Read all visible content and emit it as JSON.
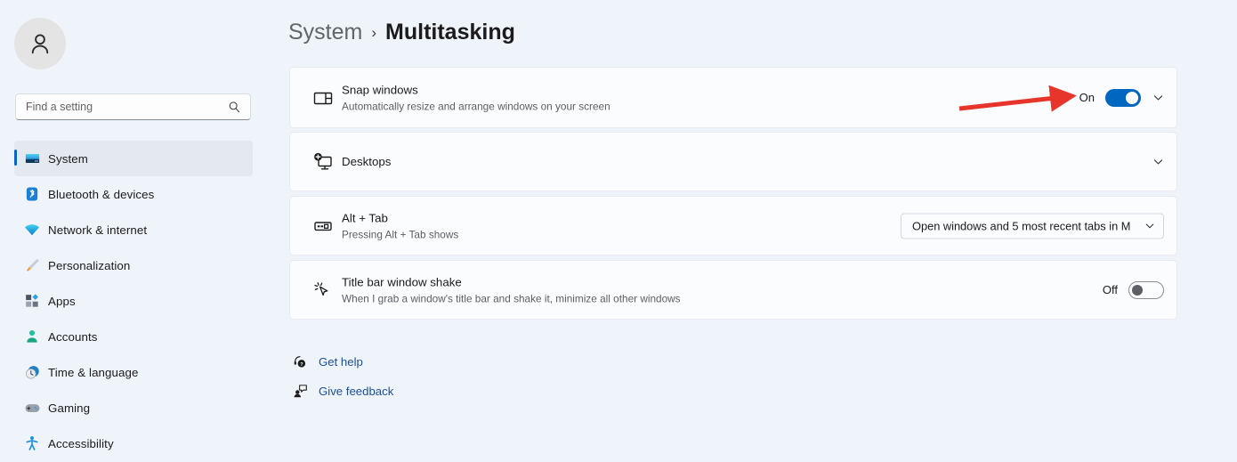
{
  "window": {
    "accent_color": "#0067c0",
    "background_color": "#eff3fa",
    "card_color": "#fbfcfe"
  },
  "sidebar": {
    "avatar": {
      "icon": "person-icon"
    },
    "search": {
      "placeholder": "Find a setting",
      "value": "",
      "icon": "search-icon"
    },
    "items": [
      {
        "label": "System",
        "icon": "monitor-icon",
        "selected": true
      },
      {
        "label": "Bluetooth & devices",
        "icon": "bluetooth-icon",
        "selected": false
      },
      {
        "label": "Network & internet",
        "icon": "wifi-icon",
        "selected": false
      },
      {
        "label": "Personalization",
        "icon": "paintbrush-icon",
        "selected": false
      },
      {
        "label": "Apps",
        "icon": "apps-grid-icon",
        "selected": false
      },
      {
        "label": "Accounts",
        "icon": "account-person-icon",
        "selected": false
      },
      {
        "label": "Time & language",
        "icon": "clock-globe-icon",
        "selected": false
      },
      {
        "label": "Gaming",
        "icon": "gamepad-icon",
        "selected": false
      },
      {
        "label": "Accessibility",
        "icon": "accessibility-person-icon",
        "selected": false
      }
    ]
  },
  "breadcrumb": {
    "parent": "System",
    "separator": "›",
    "current": "Multitasking"
  },
  "settings": [
    {
      "key": "snap_windows",
      "title": "Snap windows",
      "subtitle": "Automatically resize and arrange windows on your screen",
      "icon": "snap-layout-icon",
      "control": "toggle",
      "toggle_label": "On",
      "toggle_state": "on",
      "expander": "chevron-down-icon"
    },
    {
      "key": "desktops",
      "title": "Desktops",
      "subtitle": "",
      "icon": "desktop-add-icon",
      "control": "expander",
      "expander": "chevron-down-icon"
    },
    {
      "key": "alt_tab",
      "title": "Alt + Tab",
      "subtitle": "Pressing Alt + Tab shows",
      "icon": "alt-tab-keyboard-icon",
      "control": "dropdown",
      "dropdown_value": "Open windows and 5 most recent tabs in M",
      "expander": "chevron-down-icon"
    },
    {
      "key": "title_bar_window_shake",
      "title": "Title bar window shake",
      "subtitle": "When I grab a window's title bar and shake it, minimize all other windows",
      "icon": "cursor-shake-icon",
      "control": "toggle",
      "toggle_label": "Off",
      "toggle_state": "off"
    }
  ],
  "footer_links": [
    {
      "label": "Get help",
      "icon": "help-headset-icon"
    },
    {
      "label": "Give feedback",
      "icon": "feedback-person-icon"
    }
  ],
  "annotation": {
    "type": "arrow",
    "color": "#e8352c",
    "points_to": "snap-windows-toggle"
  }
}
